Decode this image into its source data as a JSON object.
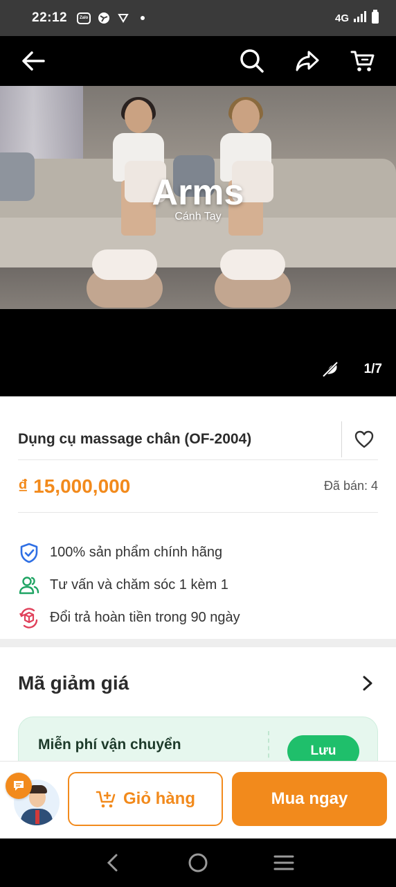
{
  "status_bar": {
    "time": "22:12",
    "network": "4G",
    "icons": [
      "zalo-icon",
      "vpn-icon",
      "data-saver-icon",
      "dot-icon",
      "signal-icon",
      "battery-icon"
    ]
  },
  "media": {
    "overlay_title": "Arms",
    "overlay_subtitle": "Cánh Tay",
    "counter": "1/7",
    "icons": [
      "back-arrow-icon",
      "search-icon",
      "share-icon",
      "cart-icon",
      "mute-icon"
    ]
  },
  "product": {
    "title": "Dụng cụ massage chân (OF-2004)",
    "price": "₫ 15,000,000",
    "sold": "Đã bán: 4",
    "features": [
      {
        "icon": "shield-check-icon",
        "text": "100% sản phẩm chính hãng",
        "color": "#2f6fe4"
      },
      {
        "icon": "users-icon",
        "text": "Tư vấn và chăm sóc 1 kèm 1",
        "color": "#1fa463"
      },
      {
        "icon": "return-box-icon",
        "text": "Đổi trả hoàn tiền trong 90 ngày",
        "color": "#e0405a"
      }
    ]
  },
  "coupon": {
    "heading": "Mã giảm giá",
    "card_title": "Miễn phí vận chuyển",
    "save_label": "Lưu"
  },
  "actions": {
    "cart_label": "Giỏ hàng",
    "buy_label": "Mua ngay"
  },
  "colors": {
    "accent": "#f28a1c",
    "green": "#1fbf6b"
  }
}
